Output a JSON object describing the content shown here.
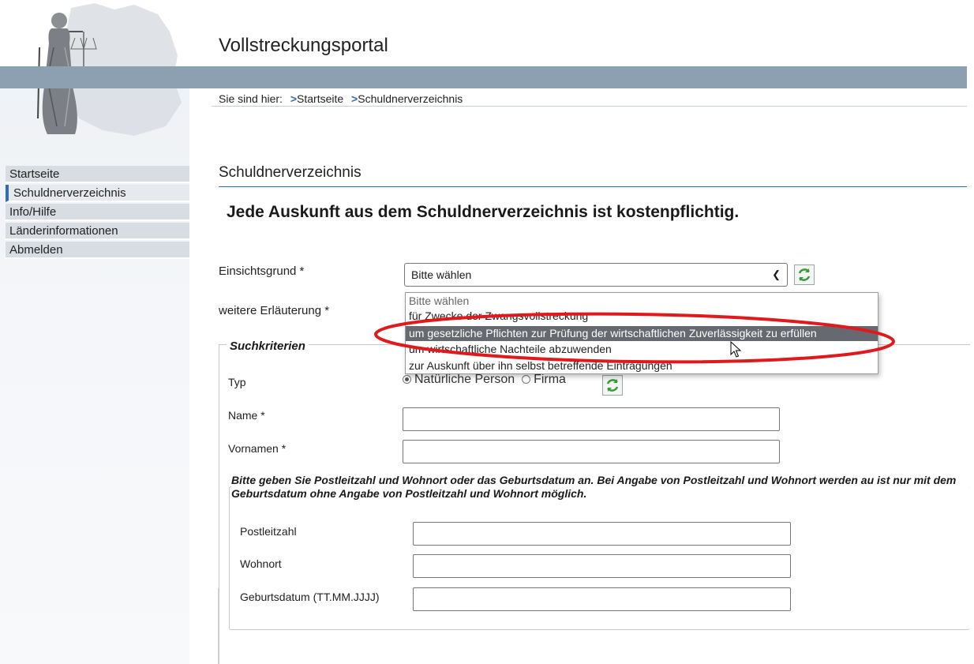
{
  "header": {
    "app_title": "Vollstreckungsportal",
    "breadcrumb_prefix": "Sie sind hier:",
    "breadcrumb_items": [
      "Startseite",
      "Schuldnerverzeichnis"
    ],
    "band_color": "#8da0b1"
  },
  "sidebar": {
    "items": [
      {
        "label": "Startseite",
        "active": false
      },
      {
        "label": "Schuldnerverzeichnis",
        "active": true
      },
      {
        "label": "Info/Hilfe",
        "active": false
      },
      {
        "label": "Länderinformationen",
        "active": false
      },
      {
        "label": "Abmelden",
        "active": false
      }
    ]
  },
  "main": {
    "section_title": "Schuldnerverzeichnis",
    "notice": "Jede Auskunft aus dem Schuldnerverzeichnis ist kostenpflichtig.",
    "reason_label": "Einsichtsgrund *",
    "reason_value": "Bitte wählen",
    "further_label": "weitere Erläuterung *",
    "dropdown_options": [
      "Bitte wählen",
      "für Zwecke der Zwangsvollstreckung",
      "um gesetzliche Pflichten zur Prüfung der wirtschaftlichen Zuverlässigkeit zu erfüllen",
      "um wirtschaftliche Nachteile abzuwenden",
      "zur Auskunft über ihn selbst betreffende Eintragungen"
    ],
    "selected_option_index": 2
  },
  "search": {
    "legend": "Suchkriterien",
    "type_label": "Typ",
    "type_options": [
      "Natürliche Person",
      "Firma"
    ],
    "type_selected": "Natürliche Person",
    "name_label": "Name *",
    "firstname_label": "Vornamen *",
    "hint": "Bitte geben Sie Postleitzahl und Wohnort oder das Geburtsdatum an. Bei Angabe von Postleitzahl und Wohnort werden au ist nur mit dem Geburtsdatum ohne Angabe von Postleitzahl und Wohnort möglich.",
    "postal_label": "Postleitzahl",
    "city_label": "Wohnort",
    "birthdate_label": "Geburtsdatum (TT.MM.JJJJ)"
  },
  "colors": {
    "accent": "#2f6db6",
    "highlight_ellipse": "#e0191c",
    "selected_option_bg": "#666a70"
  },
  "icons": {
    "refresh": "refresh-arrows-icon",
    "logo": "justitia-logo",
    "cursor": "mouse-pointer-icon"
  }
}
